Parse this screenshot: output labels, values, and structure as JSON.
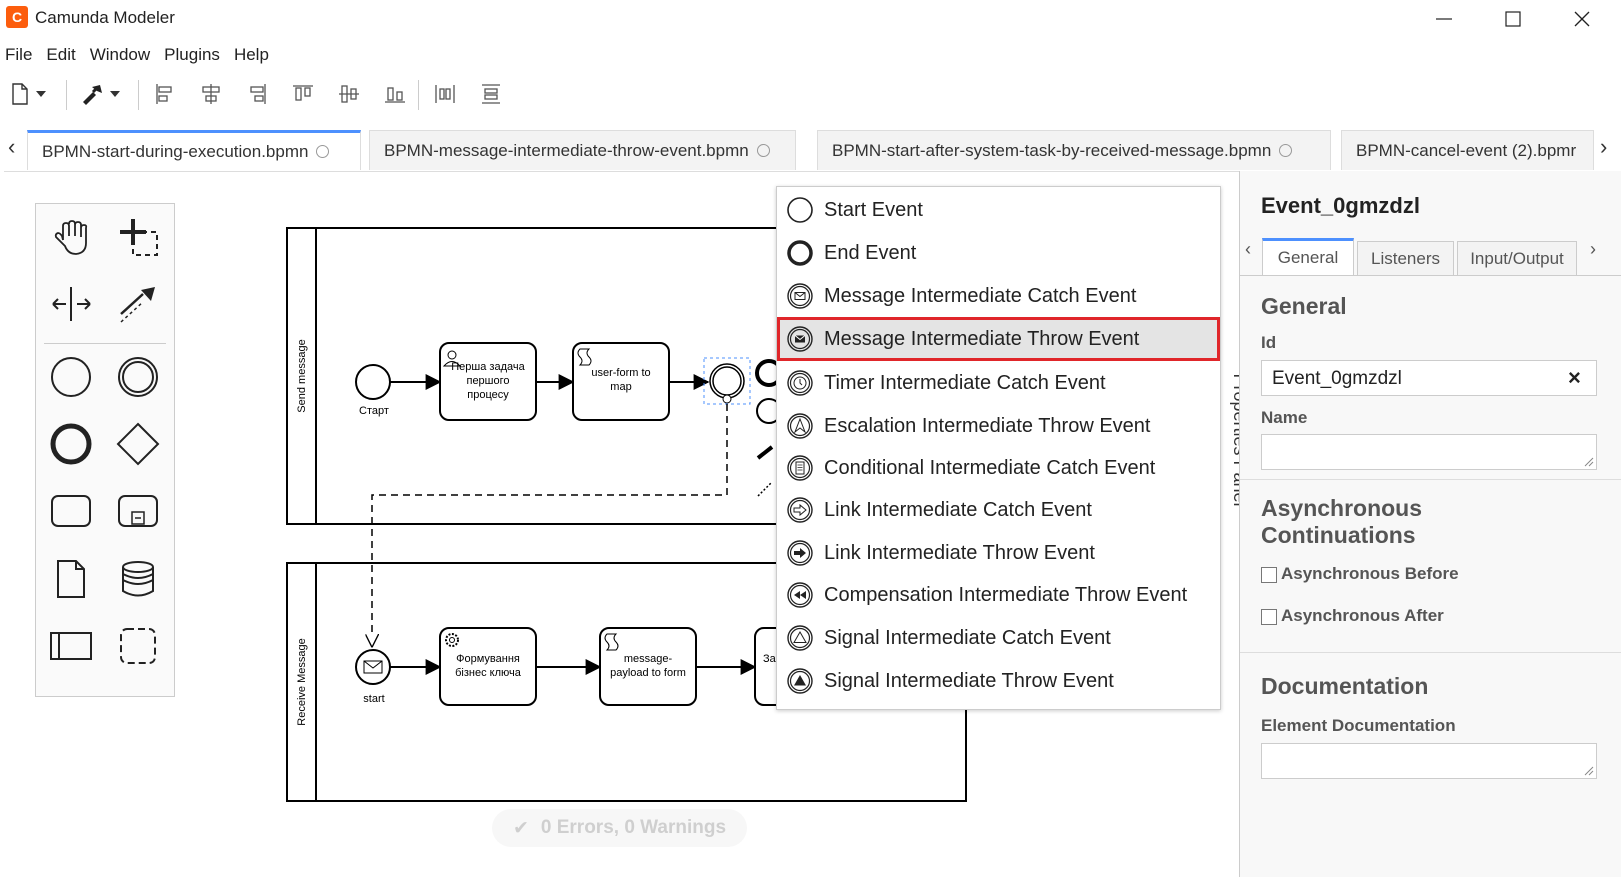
{
  "window": {
    "title": "Camunda Modeler",
    "logo_glyph": "C",
    "minimize_icon": "minimize-icon",
    "maximize_icon": "maximize-icon",
    "close_icon": "close-icon"
  },
  "menu": [
    "File",
    "Edit",
    "Window",
    "Plugins",
    "Help"
  ],
  "tabs": {
    "scroll_left": "‹",
    "scroll_right": "›",
    "items": [
      {
        "label": "BPMN-start-during-execution.bpmn",
        "active": true
      },
      {
        "label": "BPMN-message-intermediate-throw-event.bpmn",
        "active": false
      },
      {
        "label": "BPMN-start-after-system-task-by-received-message.bpmn",
        "active": false
      },
      {
        "label": "BPMN-cancel-event (2).bpmr",
        "active": false
      }
    ]
  },
  "diagram": {
    "pool1_label": "Send message",
    "pool2_label": "Receive Message",
    "start1_label": "Старт",
    "task1_lines": [
      "Перша задача",
      "першого",
      "процесу"
    ],
    "task2_lines": [
      "user-form to",
      "map"
    ],
    "start2_label": "start",
    "task3_lines": [
      "Формування",
      "бізнес ключа"
    ],
    "task4_lines": [
      "message-",
      "payload to form"
    ],
    "task5_partial": "За"
  },
  "popup": {
    "items": [
      {
        "label": "Start Event",
        "icon": "start-event-icon"
      },
      {
        "label": "End Event",
        "icon": "end-event-icon"
      },
      {
        "label": "Message Intermediate Catch Event",
        "icon": "message-catch-icon"
      },
      {
        "label": "Message Intermediate Throw Event",
        "icon": "message-throw-icon",
        "highlighted": true
      },
      {
        "label": "Timer Intermediate Catch Event",
        "icon": "timer-icon"
      },
      {
        "label": "Escalation Intermediate Throw Event",
        "icon": "escalation-icon"
      },
      {
        "label": "Conditional Intermediate Catch Event",
        "icon": "conditional-icon"
      },
      {
        "label": "Link Intermediate Catch Event",
        "icon": "link-catch-icon"
      },
      {
        "label": "Link Intermediate Throw Event",
        "icon": "link-throw-icon"
      },
      {
        "label": "Compensation Intermediate Throw Event",
        "icon": "compensation-icon"
      },
      {
        "label": "Signal Intermediate Catch Event",
        "icon": "signal-catch-icon"
      },
      {
        "label": "Signal Intermediate Throw Event",
        "icon": "signal-throw-icon"
      }
    ],
    "highlight_color": "#e0262a"
  },
  "panel_toggle_label": "Properties Panel",
  "properties": {
    "title": "Event_0gmzdzl",
    "tab_left": "‹",
    "tab_right": "›",
    "tabs": [
      "General",
      "Listeners",
      "Input/Output"
    ],
    "section_general": "General",
    "id_label": "Id",
    "id_value": "Event_0gmzdzl",
    "clear_glyph": "×",
    "name_label": "Name",
    "section_async": "Asynchronous Continuations",
    "async_before": "Asynchronous Before",
    "async_after": "Asynchronous After",
    "section_doc": "Documentation",
    "doc_label": "Element Documentation"
  },
  "status": {
    "check": "✔",
    "text": "0 Errors, 0 Warnings"
  },
  "colors": {
    "accent": "#4d90fe",
    "logo": "#fc5d0d"
  }
}
